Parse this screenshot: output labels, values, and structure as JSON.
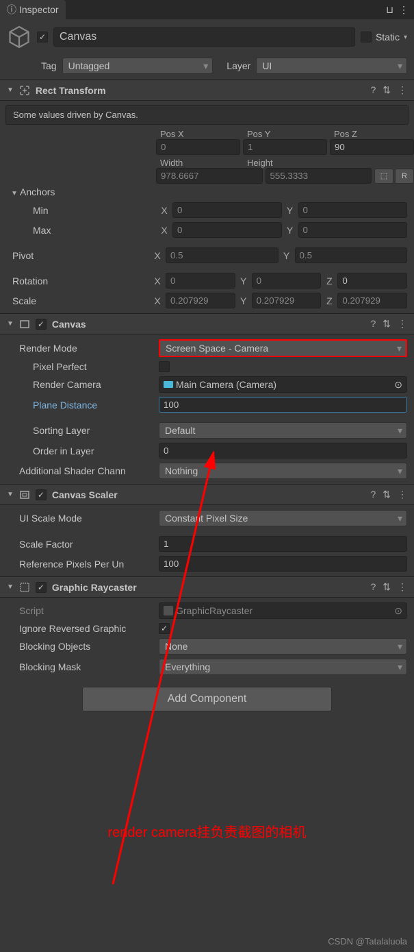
{
  "tab": {
    "title": "Inspector"
  },
  "header": {
    "name": "Canvas",
    "static_label": "Static",
    "tag_label": "Tag",
    "tag_value": "Untagged",
    "layer_label": "Layer",
    "layer_value": "UI"
  },
  "rect_transform": {
    "title": "Rect Transform",
    "info": "Some values driven by Canvas.",
    "pos_x_label": "Pos X",
    "pos_x": "0",
    "pos_y_label": "Pos Y",
    "pos_y": "1",
    "pos_z_label": "Pos Z",
    "pos_z": "90",
    "width_label": "Width",
    "width": "978.6667",
    "height_label": "Height",
    "height": "555.3333",
    "anchors_label": "Anchors",
    "min_label": "Min",
    "min_x": "0",
    "min_y": "0",
    "max_label": "Max",
    "max_x": "0",
    "max_y": "0",
    "pivot_label": "Pivot",
    "pivot_x": "0.5",
    "pivot_y": "0.5",
    "rotation_label": "Rotation",
    "rot_x": "0",
    "rot_y": "0",
    "rot_z": "0",
    "scale_label": "Scale",
    "scale_x": "0.207929",
    "scale_y": "0.207929",
    "scale_z": "0.207929",
    "x_label": "X",
    "y_label": "Y",
    "z_label": "Z"
  },
  "canvas": {
    "title": "Canvas",
    "render_mode_label": "Render Mode",
    "render_mode_value": "Screen Space - Camera",
    "pixel_perfect_label": "Pixel Perfect",
    "render_camera_label": "Render Camera",
    "render_camera_value": "Main Camera (Camera)",
    "plane_distance_label": "Plane Distance",
    "plane_distance_value": "100",
    "sorting_layer_label": "Sorting Layer",
    "sorting_layer_value": "Default",
    "order_in_layer_label": "Order in Layer",
    "order_in_layer_value": "0",
    "additional_shader_label": "Additional Shader Chann",
    "additional_shader_value": "Nothing"
  },
  "canvas_scaler": {
    "title": "Canvas Scaler",
    "ui_scale_mode_label": "UI Scale Mode",
    "ui_scale_mode_value": "Constant Pixel Size",
    "scale_factor_label": "Scale Factor",
    "scale_factor_value": "1",
    "ref_pixels_label": "Reference Pixels Per Un",
    "ref_pixels_value": "100"
  },
  "graphic_raycaster": {
    "title": "Graphic Raycaster",
    "script_label": "Script",
    "script_value": "GraphicRaycaster",
    "ignore_reversed_label": "Ignore Reversed Graphic",
    "blocking_objects_label": "Blocking Objects",
    "blocking_objects_value": "None",
    "blocking_mask_label": "Blocking Mask",
    "blocking_mask_value": "Everything"
  },
  "add_component_label": "Add Component",
  "annotation": "render camera挂负责截图的相机",
  "watermark": "CSDN @Tatalaluola"
}
